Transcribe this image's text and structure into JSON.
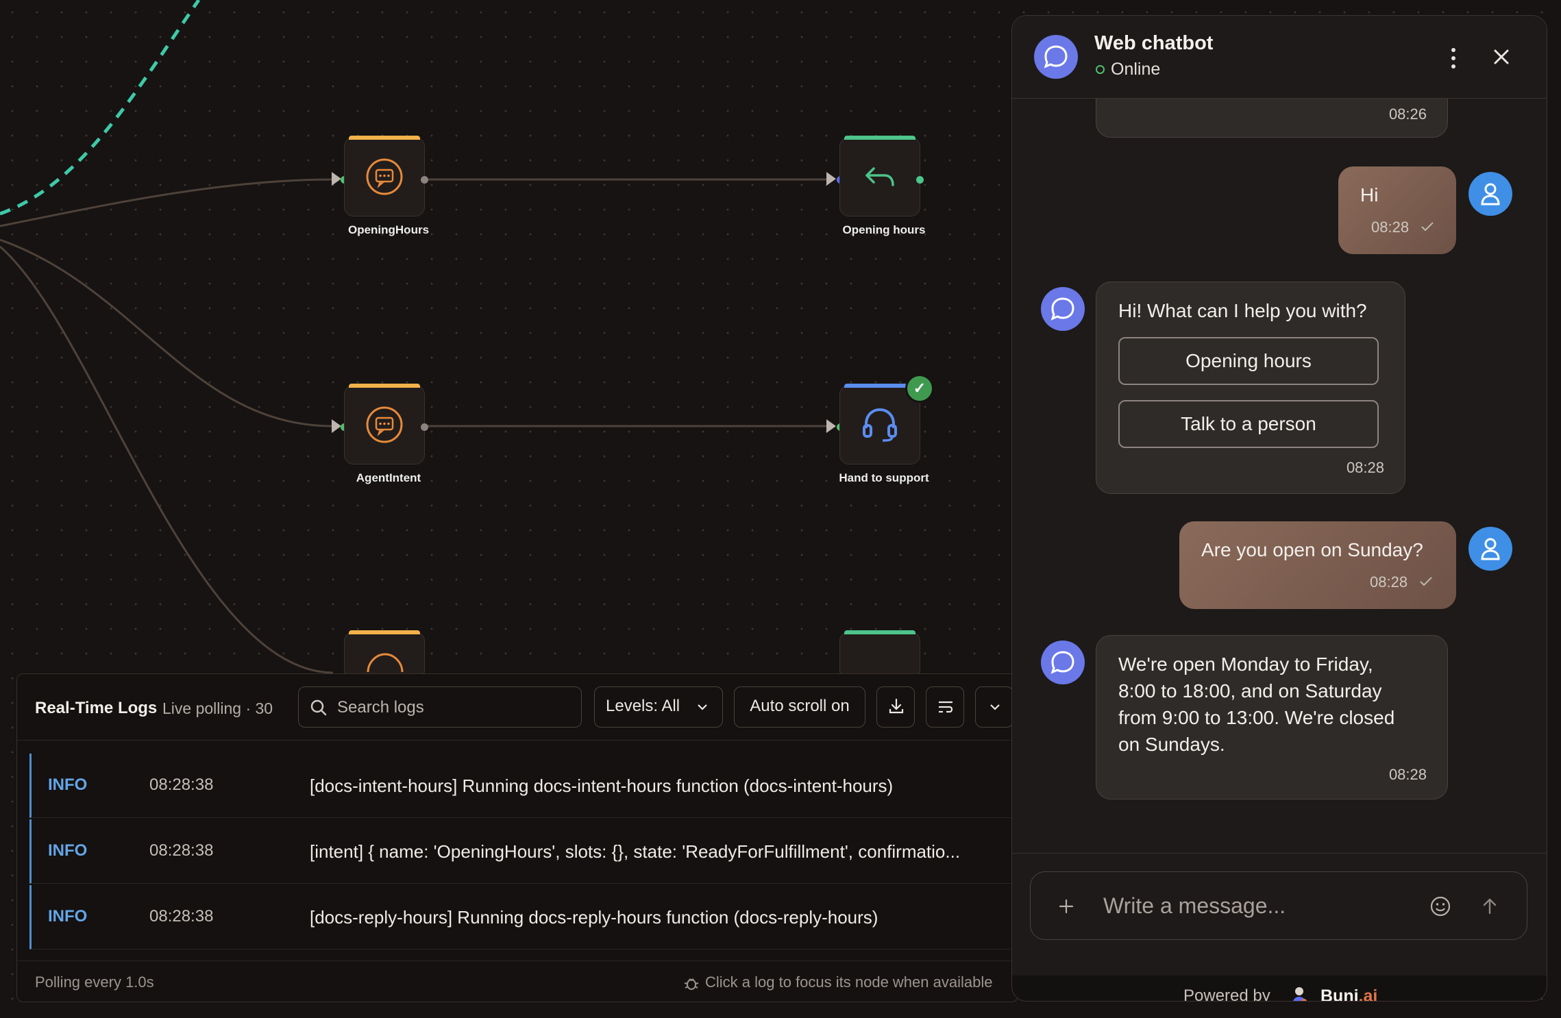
{
  "flow": {
    "nodes": {
      "opening_intent": {
        "label": "OpeningHours"
      },
      "opening_reply": {
        "label": "Opening hours"
      },
      "agent_intent": {
        "label": "AgentIntent"
      },
      "hand_support": {
        "label": "Hand to support"
      }
    },
    "colors": {
      "intent": "#f5b24a",
      "reply": "#4cc48a",
      "support": "#5b8def",
      "edge": "#5a4a40",
      "active_edge": "#3fc9a8"
    }
  },
  "logs": {
    "title": "Real-Time Logs",
    "subtitle": "Live polling · 30",
    "search_placeholder": "Search logs",
    "levels_label": "Levels: All",
    "autoscroll_label": "Auto scroll on",
    "rows": [
      {
        "level": "INFO",
        "time": "08:28:38",
        "message": "[docs-intent-hours] Running docs-intent-hours function (docs-intent-hours)"
      },
      {
        "level": "INFO",
        "time": "08:28:38",
        "message": "[intent] { name: 'OpeningHours', slots: {}, state: 'ReadyForFulfillment', confirmatio..."
      },
      {
        "level": "INFO",
        "time": "08:28:38",
        "message": "[docs-reply-hours] Running docs-reply-hours function (docs-reply-hours)"
      }
    ],
    "footer_polling": "Polling every 1.0s",
    "footer_hint": "Click a log to focus its node when available"
  },
  "chat": {
    "title": "Web chatbot",
    "status": "Online",
    "messages": {
      "prev_time": "08:26",
      "user1_text": "Hi",
      "user1_time": "08:28",
      "bot1_text": "Hi! What can I help you with?",
      "bot1_btn1": "Opening hours",
      "bot1_btn2": "Talk to a person",
      "bot1_time": "08:28",
      "user2_text": "Are you open on Sunday?",
      "user2_time": "08:28",
      "bot2_line1": "We're open Monday to Friday,",
      "bot2_line2": "8:00 to 18:00, and on Saturday",
      "bot2_line3": "from 9:00 to 13:00. We're closed",
      "bot2_line4": "on Sundays.",
      "bot2_time": "08:28"
    },
    "composer_placeholder": "Write a message...",
    "powered_by": "Powered by",
    "brand_main": "Buni",
    "brand_suffix": ".ai"
  }
}
